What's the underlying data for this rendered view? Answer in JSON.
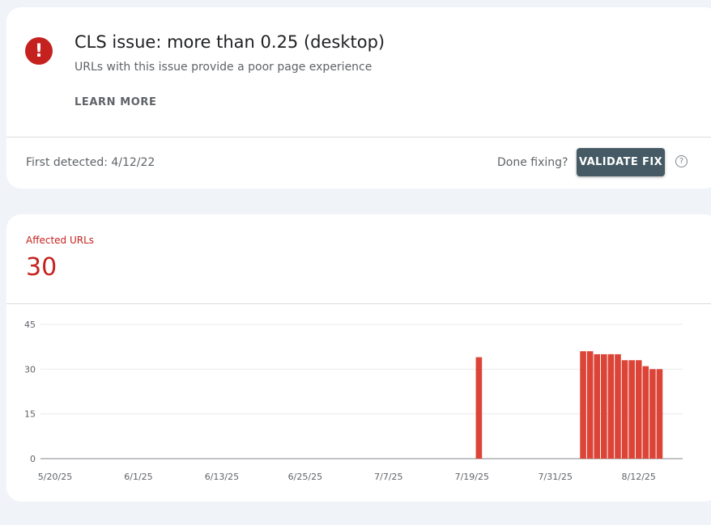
{
  "issue": {
    "icon": "error-exclamation-icon",
    "icon_glyph": "!",
    "title": "CLS issue: more than 0.25 (desktop)",
    "subtitle": "URLs with this issue provide a poor page experience",
    "learn_more": "LEARN MORE",
    "first_detected": "First detected: 4/12/22",
    "done_fixing": "Done fixing?",
    "validate_fix": "VALIDATE FIX",
    "help_icon": "help-circle-icon",
    "help_glyph": "?"
  },
  "summary": {
    "label": "Affected URLs",
    "count": "30"
  },
  "colors": {
    "error_red": "#c5221f",
    "bar_red": "#db4437",
    "button_bg": "#455a64"
  },
  "chart_data": {
    "type": "bar",
    "start_date": "5/20/25",
    "end_date": "8/20/25",
    "ylim": [
      0,
      45
    ],
    "y_ticks": [
      0,
      15,
      30,
      45
    ],
    "x_tick_labels": [
      "5/20/25",
      "6/1/25",
      "6/13/25",
      "6/25/25",
      "7/7/25",
      "7/19/25",
      "7/31/25",
      "8/12/25"
    ],
    "bars": [
      {
        "date": "7/20/25",
        "value": 34
      },
      {
        "date": "8/4/25",
        "value": 36
      },
      {
        "date": "8/5/25",
        "value": 36
      },
      {
        "date": "8/6/25",
        "value": 35
      },
      {
        "date": "8/7/25",
        "value": 35
      },
      {
        "date": "8/8/25",
        "value": 35
      },
      {
        "date": "8/9/25",
        "value": 35
      },
      {
        "date": "8/10/25",
        "value": 33
      },
      {
        "date": "8/11/25",
        "value": 33
      },
      {
        "date": "8/12/25",
        "value": 33
      },
      {
        "date": "8/13/25",
        "value": 31
      },
      {
        "date": "8/14/25",
        "value": 30
      },
      {
        "date": "8/15/25",
        "value": 30
      }
    ],
    "grid": true
  }
}
